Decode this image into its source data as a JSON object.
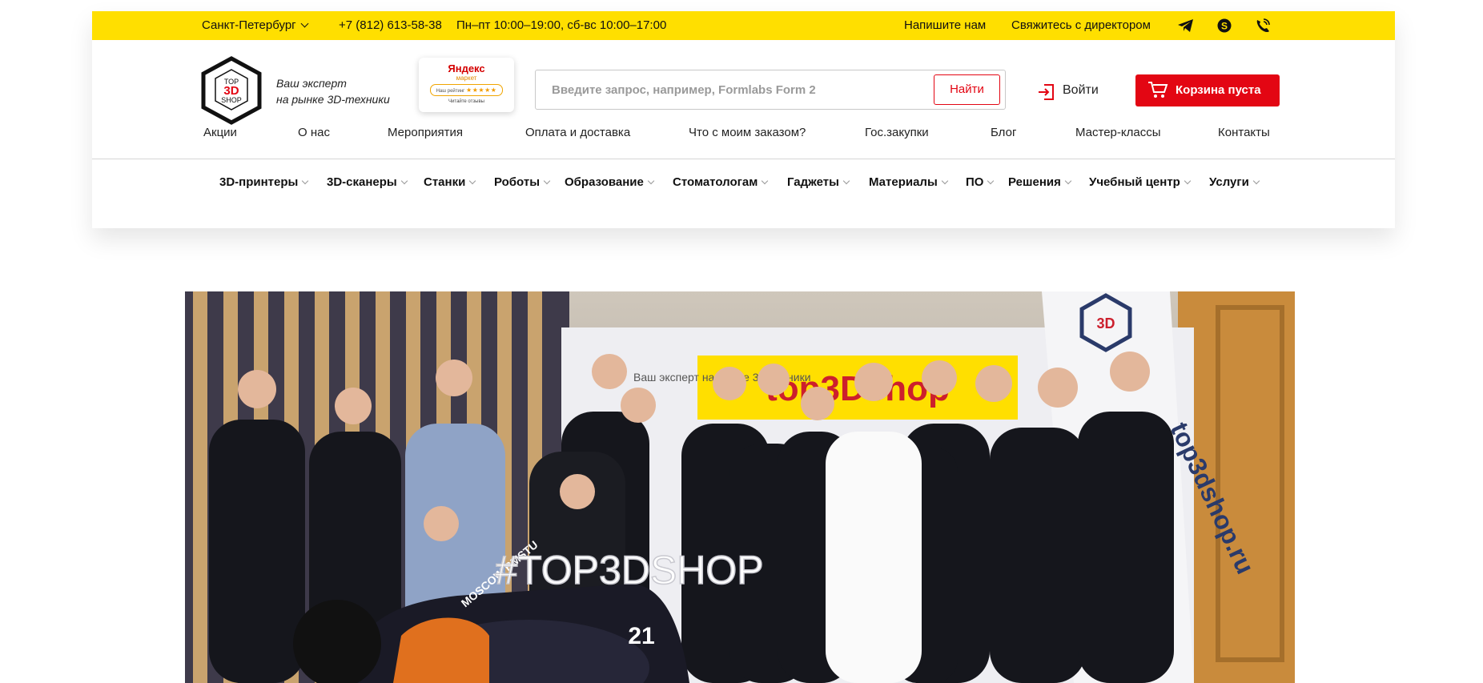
{
  "topbar": {
    "city": "Санкт-Петербург",
    "phone": "+7 (812) 613-58-38",
    "hours": "Пн–пт 10:00–19:00, сб-вс 10:00–17:00",
    "write_us": "Напишите нам",
    "contact_director": "Свяжитесь с директором",
    "icons": [
      "telegram-icon",
      "skype-icon",
      "viber-icon"
    ],
    "color": "#ffdf00"
  },
  "header": {
    "logo_text": [
      "TOP",
      "3D",
      "SHOP"
    ],
    "tagline_line1": "Ваш эксперт",
    "tagline_line2": "на рынке 3D-техники",
    "yandex_market": {
      "name": "Яндекс",
      "sub": "маркет",
      "rating_label": "Наш рейтинг",
      "stars": 5,
      "reviews": "Читайте отзывы"
    },
    "search": {
      "placeholder": "Введите запрос, например, Formlabs Form 2",
      "button": "Найти"
    },
    "login": "Войти",
    "cart": "Корзина пуста",
    "accent": "#e30613"
  },
  "secondary_nav": [
    "Акции",
    "О нас",
    "Мероприятия",
    "Оплата и доставка",
    "Что с моим заказом?",
    "Гос.закупки",
    "Блог",
    "Мастер-классы",
    "Контакты"
  ],
  "main_categories": [
    "3D-принтеры",
    "3D-сканеры",
    "Станки",
    "Роботы",
    "Образование",
    "Стоматологам",
    "Гаджеты",
    "Материалы",
    "ПО",
    "Решения",
    "Учебный центр",
    "Услуги"
  ],
  "hero": {
    "banner_word": "top3Dshop",
    "banner_tagline": "Ваш эксперт на рынке 3D-техники",
    "banner_url": "top3dshop.ru",
    "hashtag": "#TOP3DSHOP",
    "car_number": "21",
    "car_team": "MOSCOW BMSTU"
  }
}
